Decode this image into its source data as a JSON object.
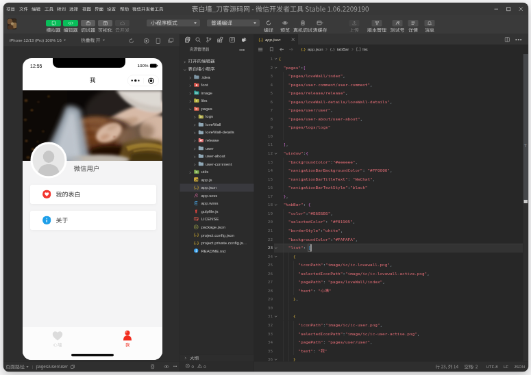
{
  "window": {
    "title": "表白墙_刀客源码网 - 微信开发者工具 Stable 1.06.2209190",
    "controls": [
      "minimize",
      "maximize",
      "close"
    ]
  },
  "menu": {
    "items": [
      "项目",
      "文件",
      "编辑",
      "工具",
      "转到",
      "选择",
      "视图",
      "界面",
      "设置",
      "帮助",
      "微信开发者工具"
    ]
  },
  "toolbar": {
    "view_buttons": [
      {
        "label": "模拟器",
        "icon": "sim-phone-icon",
        "state": "active"
      },
      {
        "label": "编辑器",
        "icon": "editor-code-icon",
        "state": "active"
      },
      {
        "label": "调试器",
        "icon": "debugger-icon",
        "state": "normal"
      },
      {
        "label": "可视化",
        "icon": "visual-icon",
        "state": "normal"
      },
      {
        "label": "云开发",
        "icon": "cloud-icon",
        "state": "disabled"
      }
    ],
    "mode_select": "小程序模式",
    "compile_select": "普通编译",
    "action_buttons": [
      {
        "label": "编译",
        "icon": "compile-refresh-icon"
      },
      {
        "label": "预览",
        "icon": "preview-eye-icon"
      },
      {
        "label": "真机调试",
        "icon": "device-debug-icon"
      },
      {
        "label": "清缓存",
        "icon": "clear-cache-icon"
      }
    ],
    "right_buttons": [
      {
        "label": "上传",
        "icon": "upload-icon",
        "state": "disabled"
      },
      {
        "label": "版本管理",
        "icon": "version-icon",
        "state": "normal"
      },
      {
        "label": "测试号",
        "icon": "testid-icon",
        "state": "normal"
      },
      {
        "label": "详情",
        "icon": "details-icon",
        "state": "normal"
      },
      {
        "label": "消息",
        "icon": "message-icon",
        "state": "normal"
      }
    ]
  },
  "simulator": {
    "device": "iPhone 12/13 (Pro) 100% 16",
    "hot_reload": "热重载 开",
    "phone": {
      "time": "12:55",
      "battery": "100%",
      "nav_title": "我",
      "nickname": "微信用户",
      "menu_items": [
        {
          "label": "我的表白",
          "icon": "heart-badge-icon"
        },
        {
          "label": "关于",
          "icon": "info-badge-icon"
        }
      ],
      "tabs": [
        {
          "label": "心墙",
          "active": false
        },
        {
          "label": "我",
          "active": true
        }
      ]
    },
    "page_path_label": "页面路径",
    "page_path": "pages/user/user"
  },
  "explorer": {
    "title": "资源管理器",
    "tree": [
      {
        "label": "打开的编辑器",
        "icon": "none",
        "lvl": 0,
        "arrow": "right",
        "section": true
      },
      {
        "label": "表白墙小程序",
        "icon": "none",
        "lvl": 0,
        "arrow": "down",
        "section": true
      },
      {
        "label": ".idea",
        "icon": "folder-idea",
        "lvl": 1,
        "arrow": "right"
      },
      {
        "label": "font",
        "icon": "folder-font",
        "lvl": 1,
        "arrow": "right"
      },
      {
        "label": "image",
        "icon": "folder-image",
        "lvl": 1,
        "arrow": "right"
      },
      {
        "label": "libs",
        "icon": "folder-libs",
        "lvl": 1,
        "arrow": "right"
      },
      {
        "label": "pages",
        "icon": "folder-pages",
        "lvl": 1,
        "arrow": "down"
      },
      {
        "label": "logs",
        "icon": "folder-logs",
        "lvl": 2,
        "arrow": "right"
      },
      {
        "label": "loveWall",
        "icon": "folder-plain",
        "lvl": 2,
        "arrow": "right"
      },
      {
        "label": "loveWall-details",
        "icon": "folder-plain",
        "lvl": 2,
        "arrow": "right"
      },
      {
        "label": "release",
        "icon": "folder-release",
        "lvl": 2,
        "arrow": "right"
      },
      {
        "label": "user",
        "icon": "folder-plain",
        "lvl": 2,
        "arrow": "right"
      },
      {
        "label": "user-about",
        "icon": "folder-plain",
        "lvl": 2,
        "arrow": "right"
      },
      {
        "label": "user-comment",
        "icon": "folder-plain",
        "lvl": 2,
        "arrow": "right"
      },
      {
        "label": "utils",
        "icon": "folder-utils",
        "lvl": 1,
        "arrow": "right"
      },
      {
        "label": "app.js",
        "icon": "file-js",
        "lvl": 1
      },
      {
        "label": "app.json",
        "icon": "file-json",
        "lvl": 1,
        "selected": true
      },
      {
        "label": "app.scss",
        "icon": "file-scss",
        "lvl": 1
      },
      {
        "label": "app.wxss",
        "icon": "file-wxss",
        "lvl": 1
      },
      {
        "label": "gulpfile.js",
        "icon": "file-gulp",
        "lvl": 1
      },
      {
        "label": "LICENSE",
        "icon": "file-license",
        "lvl": 1
      },
      {
        "label": "package.json",
        "icon": "file-npm",
        "lvl": 1
      },
      {
        "label": "project.config.json",
        "icon": "file-json",
        "lvl": 1
      },
      {
        "label": "project.private.config.js...",
        "icon": "file-json",
        "lvl": 1
      },
      {
        "label": "README.md",
        "icon": "file-readme",
        "lvl": 1
      }
    ],
    "outline": "大纲",
    "problems": {
      "errors": "0",
      "warnings": "0"
    }
  },
  "editor": {
    "tab": {
      "label": "app.json",
      "icon": "json-braces-icon"
    },
    "breadcrumb": [
      {
        "label": "app.json",
        "icon": "braces"
      },
      {
        "label": "tabBar",
        "icon": "braces"
      },
      {
        "label": "list",
        "icon": "brackets"
      }
    ],
    "code": {
      "lines": [
        {
          "n": 1,
          "ind": 0,
          "fold": true,
          "guides": [],
          "tokens": [
            [
              "{",
              "b1"
            ]
          ]
        },
        {
          "n": 2,
          "ind": 2,
          "fold": true,
          "guides": [],
          "tokens": [
            [
              "\"pages\"",
              "k"
            ],
            [
              ":",
              "p"
            ],
            [
              "[",
              "b2"
            ]
          ]
        },
        {
          "n": 3,
          "ind": 4,
          "fold": false,
          "guides": [
            2
          ],
          "tokens": [
            [
              "\"pages/loveWall/index\"",
              "v"
            ],
            [
              ",",
              "p"
            ]
          ]
        },
        {
          "n": 4,
          "ind": 4,
          "fold": false,
          "guides": [
            2
          ],
          "tokens": [
            [
              "\"pages/user-comment/user-comment\"",
              "v"
            ],
            [
              ",",
              "p"
            ]
          ]
        },
        {
          "n": 5,
          "ind": 4,
          "fold": false,
          "guides": [
            2
          ],
          "tokens": [
            [
              "\"pages/release/release\"",
              "v"
            ],
            [
              ",",
              "p"
            ]
          ]
        },
        {
          "n": 6,
          "ind": 4,
          "fold": false,
          "guides": [
            2
          ],
          "tokens": [
            [
              "\"pages/loveWall-details/loveWall-details\"",
              "v"
            ],
            [
              ",",
              "p"
            ]
          ]
        },
        {
          "n": 7,
          "ind": 4,
          "fold": false,
          "guides": [
            2
          ],
          "tokens": [
            [
              "\"pages/user/user\"",
              "v"
            ],
            [
              ",",
              "p"
            ]
          ]
        },
        {
          "n": 8,
          "ind": 4,
          "fold": false,
          "guides": [
            2
          ],
          "tokens": [
            [
              "\"pages/user-about/user-about\"",
              "v"
            ],
            [
              ",",
              "p"
            ]
          ]
        },
        {
          "n": 9,
          "ind": 4,
          "fold": false,
          "guides": [
            2
          ],
          "tokens": [
            [
              "\"pages/logs/logs\"",
              "v"
            ]
          ]
        },
        {
          "n": 10,
          "ind": 0,
          "fold": false,
          "guides": [
            2
          ],
          "tokens": []
        },
        {
          "n": 11,
          "ind": 2,
          "fold": false,
          "guides": [],
          "tokens": [
            [
              "]",
              "b2"
            ],
            [
              ",",
              "p"
            ]
          ]
        },
        {
          "n": 12,
          "ind": 2,
          "fold": true,
          "guides": [],
          "tokens": [
            [
              "\"window\"",
              "k"
            ],
            [
              ":",
              "p"
            ],
            [
              "{",
              "b2"
            ]
          ]
        },
        {
          "n": 13,
          "ind": 4,
          "fold": false,
          "guides": [
            2
          ],
          "tokens": [
            [
              "\"backgroundColor\"",
              "k"
            ],
            [
              ":",
              "p"
            ],
            [
              "\"#eeeeee\"",
              "v"
            ],
            [
              ",",
              "p"
            ]
          ]
        },
        {
          "n": 14,
          "ind": 4,
          "fold": false,
          "guides": [
            2
          ],
          "tokens": [
            [
              "\"navigationBarBackgroundColor\"",
              "k"
            ],
            [
              ": ",
              "p"
            ],
            [
              "\"#FF0000\"",
              "v"
            ],
            [
              ",",
              "p"
            ]
          ]
        },
        {
          "n": 15,
          "ind": 4,
          "fold": false,
          "guides": [
            2
          ],
          "tokens": [
            [
              "\"navigationBarTitleText\"",
              "k"
            ],
            [
              ": ",
              "p"
            ],
            [
              "\"WeChat\"",
              "v"
            ],
            [
              ",",
              "p"
            ]
          ]
        },
        {
          "n": 16,
          "ind": 4,
          "fold": false,
          "guides": [
            2
          ],
          "tokens": [
            [
              "\"navigationBarTextStyle\"",
              "k"
            ],
            [
              ":",
              "p"
            ],
            [
              "\"black\"",
              "v"
            ]
          ]
        },
        {
          "n": 17,
          "ind": 2,
          "fold": false,
          "guides": [],
          "tokens": [
            [
              "}",
              "b2"
            ],
            [
              ",",
              "p"
            ]
          ]
        },
        {
          "n": 18,
          "ind": 2,
          "fold": true,
          "guides": [],
          "tokens": [
            [
              "\"tabBar\"",
              "k"
            ],
            [
              ": ",
              "p"
            ],
            [
              "{",
              "b2"
            ]
          ]
        },
        {
          "n": 19,
          "ind": 4,
          "fold": false,
          "guides": [
            2
          ],
          "tokens": [
            [
              "\"color\"",
              "k"
            ],
            [
              ":",
              "p"
            ],
            [
              "\"#E6E6E6\"",
              "v"
            ],
            [
              ",",
              "p"
            ]
          ]
        },
        {
          "n": 20,
          "ind": 4,
          "fold": false,
          "guides": [
            2
          ],
          "tokens": [
            [
              "\"selectedColor\"",
              "k"
            ],
            [
              ": ",
              "p"
            ],
            [
              "\"#F01905\"",
              "v"
            ],
            [
              ",",
              "p"
            ]
          ]
        },
        {
          "n": 21,
          "ind": 4,
          "fold": false,
          "guides": [
            2
          ],
          "tokens": [
            [
              "\"borderStyle\"",
              "k"
            ],
            [
              ":",
              "p"
            ],
            [
              "\"white\"",
              "v"
            ],
            [
              ",",
              "p"
            ]
          ]
        },
        {
          "n": 22,
          "ind": 4,
          "fold": false,
          "guides": [
            2
          ],
          "tokens": [
            [
              "\"backgroundColor\"",
              "k"
            ],
            [
              ":",
              "p"
            ],
            [
              "\"#FAFAFA\"",
              "v"
            ],
            [
              ",",
              "p"
            ]
          ]
        },
        {
          "n": 23,
          "ind": 4,
          "fold": true,
          "guides": [
            2
          ],
          "tokens": [
            [
              "\"list\"",
              "k"
            ],
            [
              ": ",
              "p"
            ],
            [
              "[",
              "b3"
            ]
          ]
        },
        {
          "n": 24,
          "ind": 6,
          "fold": true,
          "guides": [
            2,
            4
          ],
          "tokens": [
            [
              "{",
              "b1"
            ]
          ]
        },
        {
          "n": 25,
          "ind": 8,
          "fold": false,
          "guides": [
            2,
            4,
            6
          ],
          "tokens": [
            [
              "\"iconPath\"",
              "k"
            ],
            [
              ":",
              "p"
            ],
            [
              "\"image/ic/ic-lovewall.png\"",
              "v"
            ],
            [
              ",",
              "p"
            ]
          ]
        },
        {
          "n": 26,
          "ind": 8,
          "fold": false,
          "guides": [
            2,
            4,
            6
          ],
          "tokens": [
            [
              "\"selectedIconPath\"",
              "k"
            ],
            [
              ":",
              "p"
            ],
            [
              "\"image/ic/ic-lovewall-active.png\"",
              "v"
            ],
            [
              ",",
              "p"
            ]
          ]
        },
        {
          "n": 27,
          "ind": 8,
          "fold": false,
          "guides": [
            2,
            4,
            6
          ],
          "tokens": [
            [
              "\"pagePath\"",
              "k"
            ],
            [
              ": ",
              "p"
            ],
            [
              "\"pages/loveWall/index\"",
              "v"
            ],
            [
              ",",
              "p"
            ]
          ]
        },
        {
          "n": 28,
          "ind": 8,
          "fold": false,
          "guides": [
            2,
            4,
            6
          ],
          "tokens": [
            [
              "\"text\"",
              "k"
            ],
            [
              ": ",
              "p"
            ],
            [
              "\"心墙\"",
              "v"
            ]
          ]
        },
        {
          "n": 29,
          "ind": 6,
          "fold": false,
          "guides": [
            2,
            4
          ],
          "tokens": [
            [
              "}",
              "b1"
            ],
            [
              ",",
              "p"
            ]
          ]
        },
        {
          "n": 30,
          "ind": 0,
          "fold": false,
          "guides": [
            2,
            4
          ],
          "tokens": []
        },
        {
          "n": 31,
          "ind": 6,
          "fold": true,
          "guides": [
            2,
            4
          ],
          "tokens": [
            [
              "{",
              "b1"
            ]
          ]
        },
        {
          "n": 32,
          "ind": 8,
          "fold": false,
          "guides": [
            2,
            4,
            6
          ],
          "tokens": [
            [
              "\"iconPath\"",
              "k"
            ],
            [
              ":",
              "p"
            ],
            [
              "\"image/ic/ic-user.png\"",
              "v"
            ],
            [
              ",",
              "p"
            ]
          ]
        },
        {
          "n": 33,
          "ind": 8,
          "fold": false,
          "guides": [
            2,
            4,
            6
          ],
          "tokens": [
            [
              "\"selectedIconPath\"",
              "k"
            ],
            [
              ":",
              "p"
            ],
            [
              "\"image/ic/ic-user-active.png\"",
              "v"
            ],
            [
              ",",
              "p"
            ]
          ]
        },
        {
          "n": 34,
          "ind": 8,
          "fold": false,
          "guides": [
            2,
            4,
            6
          ],
          "tokens": [
            [
              "\"pagePath\"",
              "k"
            ],
            [
              ": ",
              "p"
            ],
            [
              "\"pages/user/user\"",
              "v"
            ],
            [
              ",",
              "p"
            ]
          ]
        },
        {
          "n": 35,
          "ind": 8,
          "fold": false,
          "guides": [
            2,
            4,
            6
          ],
          "tokens": [
            [
              "\"text\"",
              "k"
            ],
            [
              ": ",
              "p"
            ],
            [
              "\"我\"",
              "v"
            ]
          ]
        },
        {
          "n": 36,
          "ind": 6,
          "fold": true,
          "guides": [
            2,
            4
          ],
          "tokens": [
            [
              "}",
              "b1"
            ]
          ]
        }
      ],
      "cursor": {
        "line": 23,
        "col": 14
      }
    }
  },
  "statusbar": {
    "line_col": "行 23, 列 14",
    "spaces": "空格: 2",
    "encoding": "UTF-8",
    "eol": "LF",
    "lang": "JSON"
  },
  "palette": {
    "wechat_green": "#06b456",
    "code_key": "#e06c75",
    "code_value": "#e06c75",
    "bracket1": "#d5b23f",
    "bracket2": "#cf6fd3",
    "bracket3": "#3fa2e8",
    "tab_red": "#f12c1e",
    "info_blue": "#1e9fe9"
  }
}
